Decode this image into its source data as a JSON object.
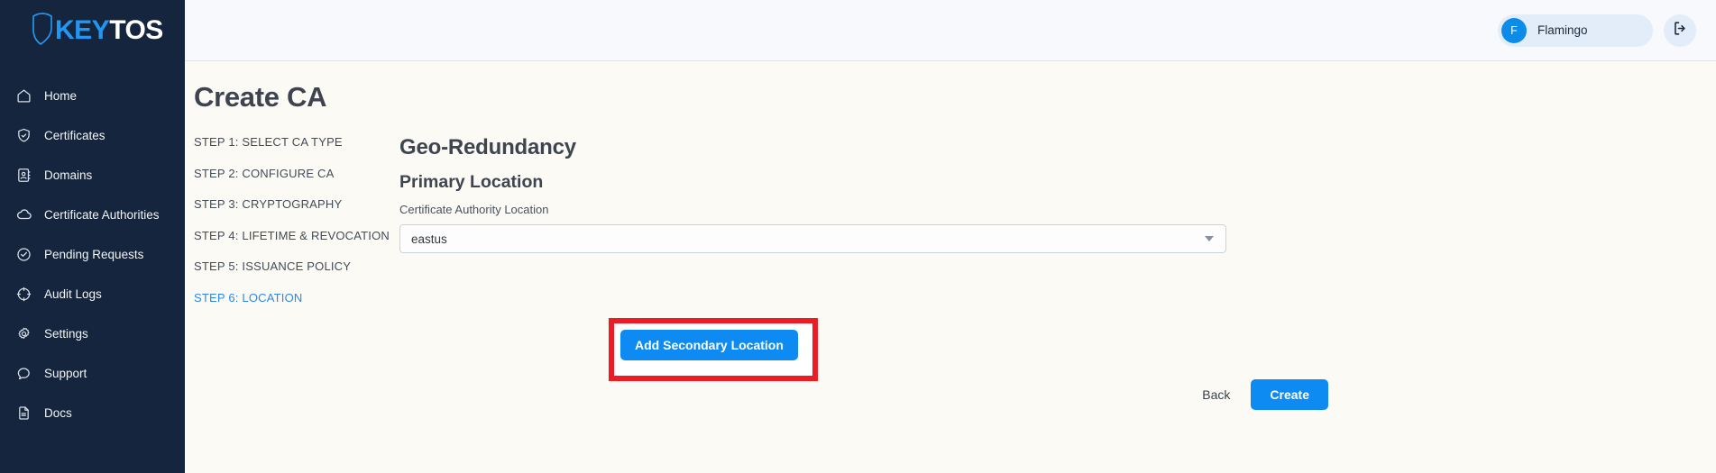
{
  "brand": {
    "logo_key": "KEY",
    "logo_tos": "TOS",
    "shield_icon": "shield-icon",
    "accent_blue": "#2196f3",
    "sidebar_bg": "#14253d"
  },
  "sidebar": {
    "items": [
      {
        "label": "Home",
        "icon": "home-icon",
        "name": "sidebar-item-home"
      },
      {
        "label": "Certificates",
        "icon": "shield-check-icon",
        "name": "sidebar-item-certificates"
      },
      {
        "label": "Domains",
        "icon": "address-book-icon",
        "name": "sidebar-item-domains"
      },
      {
        "label": "Certificate Authorities",
        "icon": "cloud-icon",
        "name": "sidebar-item-certificate-authorities"
      },
      {
        "label": "Pending Requests",
        "icon": "check-circle-icon",
        "name": "sidebar-item-pending-requests"
      },
      {
        "label": "Audit Logs",
        "icon": "target-icon",
        "name": "sidebar-item-audit-logs"
      },
      {
        "label": "Settings",
        "icon": "gear-icon",
        "name": "sidebar-item-settings"
      },
      {
        "label": "Support",
        "icon": "chat-bubble-icon",
        "name": "sidebar-item-support"
      },
      {
        "label": "Docs",
        "icon": "document-icon",
        "name": "sidebar-item-docs"
      }
    ]
  },
  "topbar": {
    "avatar_initial": "F",
    "user_name": "Flamingo",
    "logout_icon": "logout-icon"
  },
  "page": {
    "title": "Create CA"
  },
  "steps": [
    {
      "label": "STEP 1: SELECT CA TYPE",
      "active": false
    },
    {
      "label": "STEP 2: CONFIGURE CA",
      "active": false
    },
    {
      "label": "STEP 3: CRYPTOGRAPHY",
      "active": false
    },
    {
      "label": "STEP 4: LIFETIME & REVOCATION",
      "active": false
    },
    {
      "label": "STEP 5: ISSUANCE POLICY",
      "active": false
    },
    {
      "label": "STEP 6: LOCATION",
      "active": true
    }
  ],
  "panel": {
    "heading": "Geo-Redundancy",
    "subheading": "Primary Location",
    "field_label": "Certificate Authority Location",
    "location_value": "eastus",
    "location_options": [
      "eastus"
    ],
    "add_secondary_label": "Add Secondary Location",
    "back_label": "Back",
    "create_label": "Create",
    "highlight_color": "#ed1c24",
    "primary_button_color": "#0d8bf2"
  }
}
